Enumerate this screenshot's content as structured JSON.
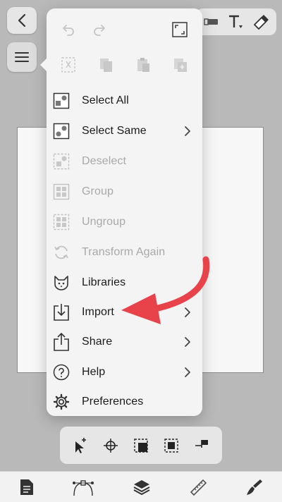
{
  "menu": {
    "items": [
      {
        "label": "Select All",
        "enabled": true,
        "icon": "select-all-icon"
      },
      {
        "label": "Select Same",
        "enabled": true,
        "icon": "select-same-icon",
        "submenu": true
      },
      {
        "label": "Deselect",
        "enabled": false,
        "icon": "deselect-icon"
      },
      {
        "label": "Group",
        "enabled": false,
        "icon": "group-icon"
      },
      {
        "label": "Ungroup",
        "enabled": false,
        "icon": "ungroup-icon"
      },
      {
        "label": "Transform Again",
        "enabled": false,
        "icon": "transform-again-icon"
      },
      {
        "label": "Libraries",
        "enabled": true,
        "icon": "libraries-cat-icon"
      },
      {
        "label": "Import",
        "enabled": true,
        "icon": "import-icon",
        "submenu": true
      },
      {
        "label": "Share",
        "enabled": true,
        "icon": "share-icon",
        "submenu": true
      },
      {
        "label": "Help",
        "enabled": true,
        "icon": "help-icon",
        "submenu": true
      },
      {
        "label": "Preferences",
        "enabled": true,
        "icon": "gear-icon"
      }
    ]
  },
  "colors": {
    "annotation_arrow": "#e8424a",
    "menu_bg": "#f4f4f4",
    "disabled_text": "#a9a9a9"
  }
}
